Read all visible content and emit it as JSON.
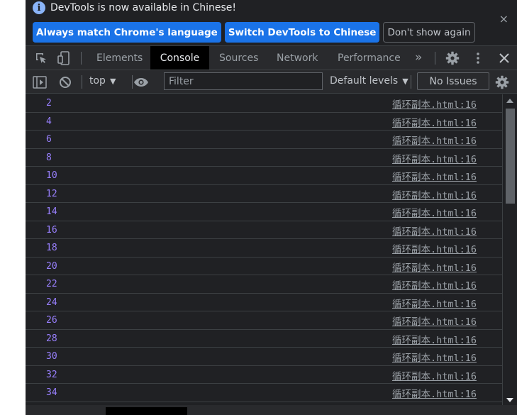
{
  "infobar": {
    "message": "DevTools is now available in Chinese!",
    "buttons": {
      "always_match": "Always match Chrome's language",
      "switch": "Switch DevTools to Chinese",
      "dont_show": "Don't show again"
    },
    "close_glyph": "×"
  },
  "tabs": {
    "items": [
      "Elements",
      "Console",
      "Sources",
      "Network",
      "Performance"
    ],
    "active": "Console",
    "more_glyph": "»"
  },
  "console_toolbar": {
    "context": "top",
    "filter_placeholder": "Filter",
    "levels": "Default levels",
    "issues": "No Issues"
  },
  "log": {
    "source_link": "循环副本.html:16",
    "entries": [
      "2",
      "4",
      "6",
      "8",
      "10",
      "12",
      "14",
      "16",
      "18",
      "20",
      "22",
      "24",
      "26",
      "28",
      "30",
      "32",
      "34"
    ]
  },
  "colors": {
    "background": "#202124",
    "toolbar": "#292a2d",
    "number": "#9980ff",
    "primary_button": "#1a73e8",
    "text": "#e8eaed"
  }
}
